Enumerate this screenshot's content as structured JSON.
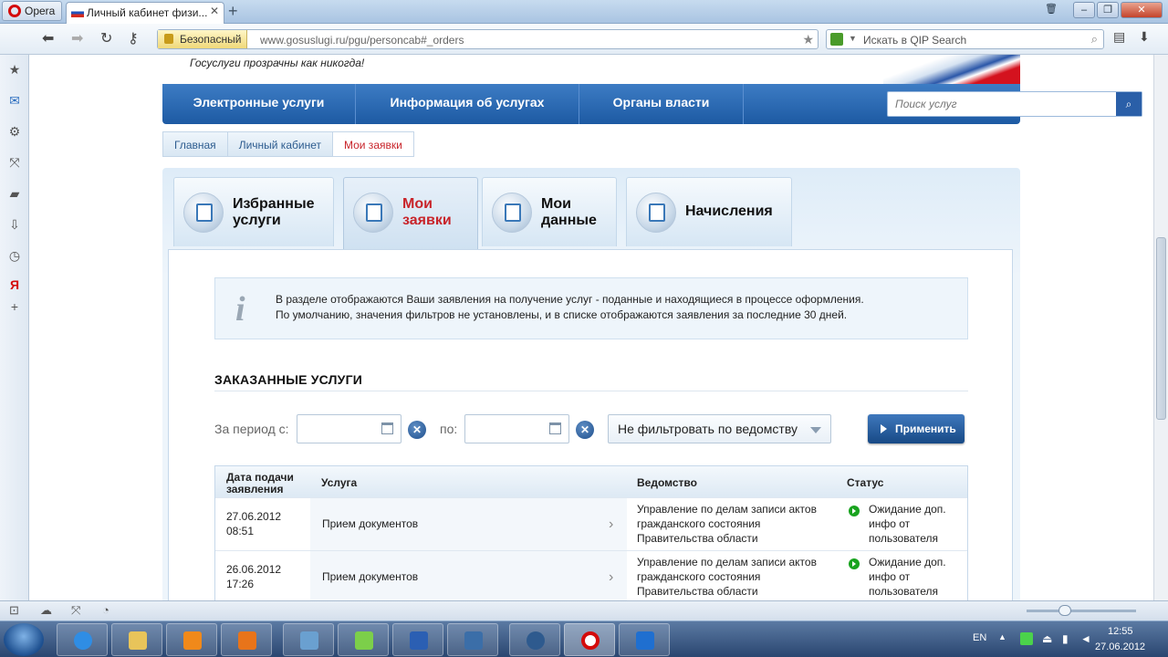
{
  "browser": {
    "menu_label": "Opera",
    "tab_title": "Личный кабинет физи...",
    "secure_label": "Безопасный",
    "url": "www.gosuslugi.ru/pgu/personcab#_orders",
    "search_placeholder": "Искать в QIP Search"
  },
  "site": {
    "tagline": "Госуслуги прозрачны как никогда!",
    "nav": [
      "Электронные услуги",
      "Информация об услугах",
      "Органы власти"
    ],
    "search_placeholder": "Поиск услуг",
    "breadcrumb": [
      "Главная",
      "Личный кабинет",
      "Мои заявки"
    ]
  },
  "cabinet_tabs": [
    {
      "line1": "Избранные",
      "line2": "услуги"
    },
    {
      "line1": "Мои",
      "line2": "заявки"
    },
    {
      "line1": "Мои",
      "line2": "данные"
    },
    {
      "line1": "Начисления",
      "line2": ""
    }
  ],
  "info": {
    "line1": "В разделе отображаются Ваши заявления на получение услуг - поданные и находящиеся в процессе оформления.",
    "line2": "По умолчанию, значения фильтров не установлены, и в списке отображаются заявления за последние 30 дней."
  },
  "section_title": "ЗАКАЗАННЫЕ УСЛУГИ",
  "filters": {
    "period_from_label": "За период с:",
    "period_to_label": "по:",
    "department_select": "Не фильтровать по ведомству",
    "apply_label": "Применить"
  },
  "orders": {
    "headers": {
      "date_line1": "Дата подачи",
      "date_line2": "заявления",
      "service": "Услуга",
      "department": "Ведомство",
      "status": "Статус"
    },
    "rows": [
      {
        "date": "27.06.2012",
        "time": "08:51",
        "service": "Прием документов",
        "dept1": "Управление по делам записи актов",
        "dept2": "гражданского состояния",
        "dept3": "Правительства области",
        "status1": "Ожидание доп.",
        "status2": "инфо от",
        "status3": "пользователя"
      },
      {
        "date": "26.06.2012",
        "time": "17:26",
        "service": "Прием документов",
        "dept1": "Управление по делам записи актов",
        "dept2": "гражданского состояния",
        "dept3": "Правительства области",
        "status1": "Ожидание доп.",
        "status2": "инфо от",
        "status3": "пользователя"
      }
    ]
  },
  "taskbar": {
    "lang": "EN",
    "time": "12:55",
    "date": "27.06.2012"
  }
}
